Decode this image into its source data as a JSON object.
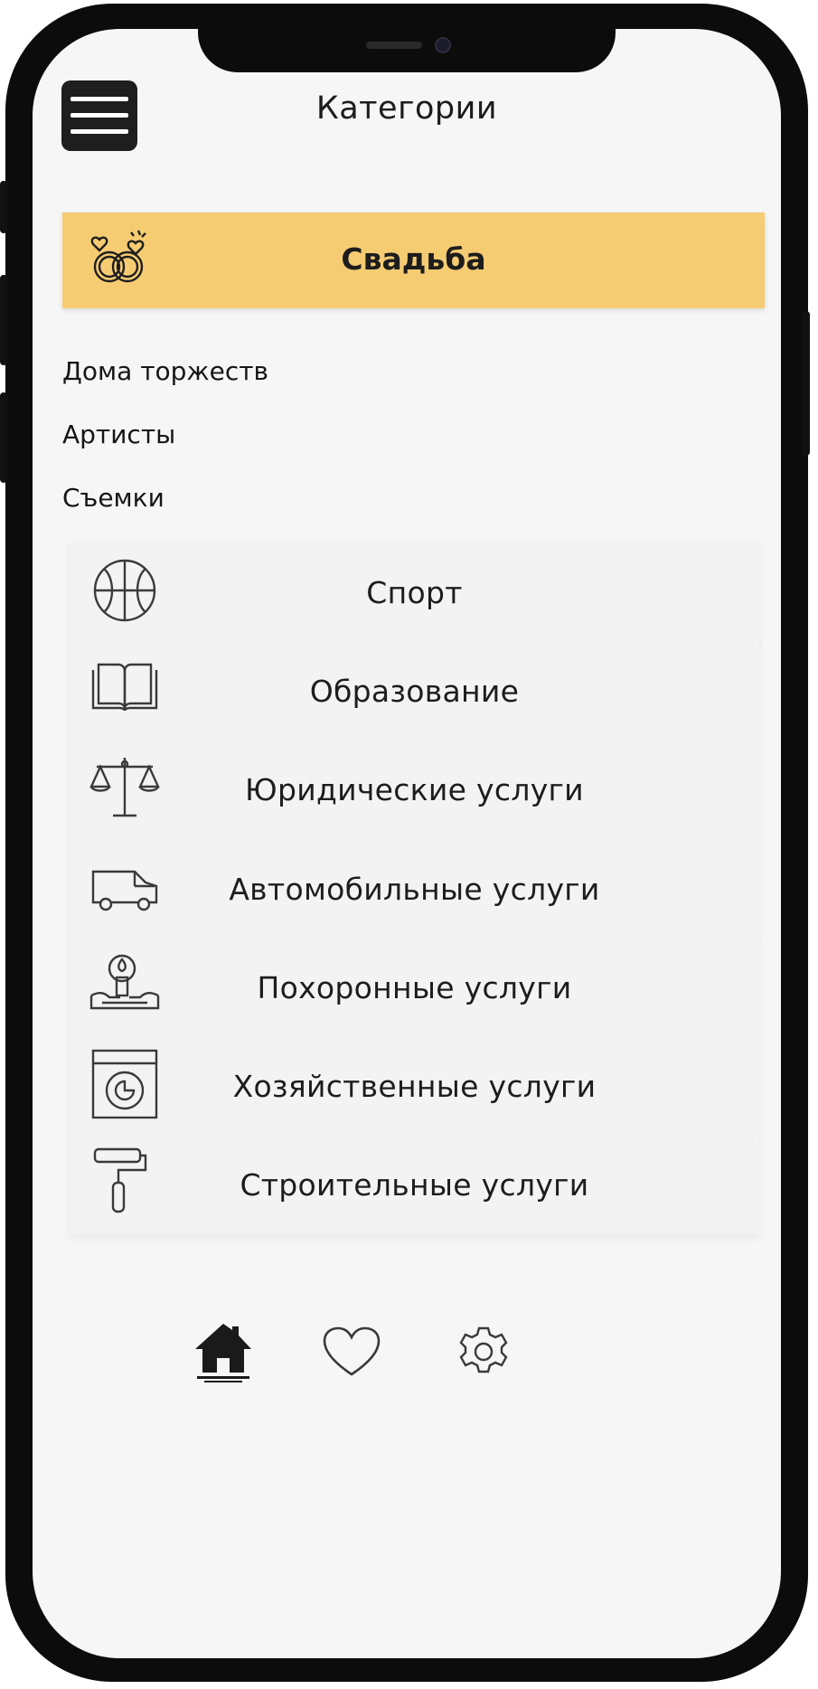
{
  "header": {
    "title": "Категории"
  },
  "active_category": {
    "label": "Свадьба",
    "icon": "wedding-rings-icon",
    "highlight_color": "#f6cc72"
  },
  "subcategories": [
    {
      "label": "Дома торжеств"
    },
    {
      "label": "Артисты"
    },
    {
      "label": "Съемки"
    }
  ],
  "categories": [
    {
      "label": "Спорт",
      "icon": "basketball-icon"
    },
    {
      "label": "Образование",
      "icon": "book-icon"
    },
    {
      "label": "Юридические услуги",
      "icon": "scales-icon"
    },
    {
      "label": "Автомобильные услуги",
      "icon": "van-icon"
    },
    {
      "label": "Похоронные услуги",
      "icon": "candle-icon"
    },
    {
      "label": "Хозяйственные услуги",
      "icon": "washing-machine-icon"
    },
    {
      "label": "Строительные услуги",
      "icon": "paint-roller-icon"
    }
  ],
  "bottom_nav": {
    "items": [
      {
        "icon": "home-icon",
        "active": true
      },
      {
        "icon": "heart-icon",
        "active": false
      },
      {
        "icon": "gear-icon",
        "active": false
      }
    ]
  }
}
